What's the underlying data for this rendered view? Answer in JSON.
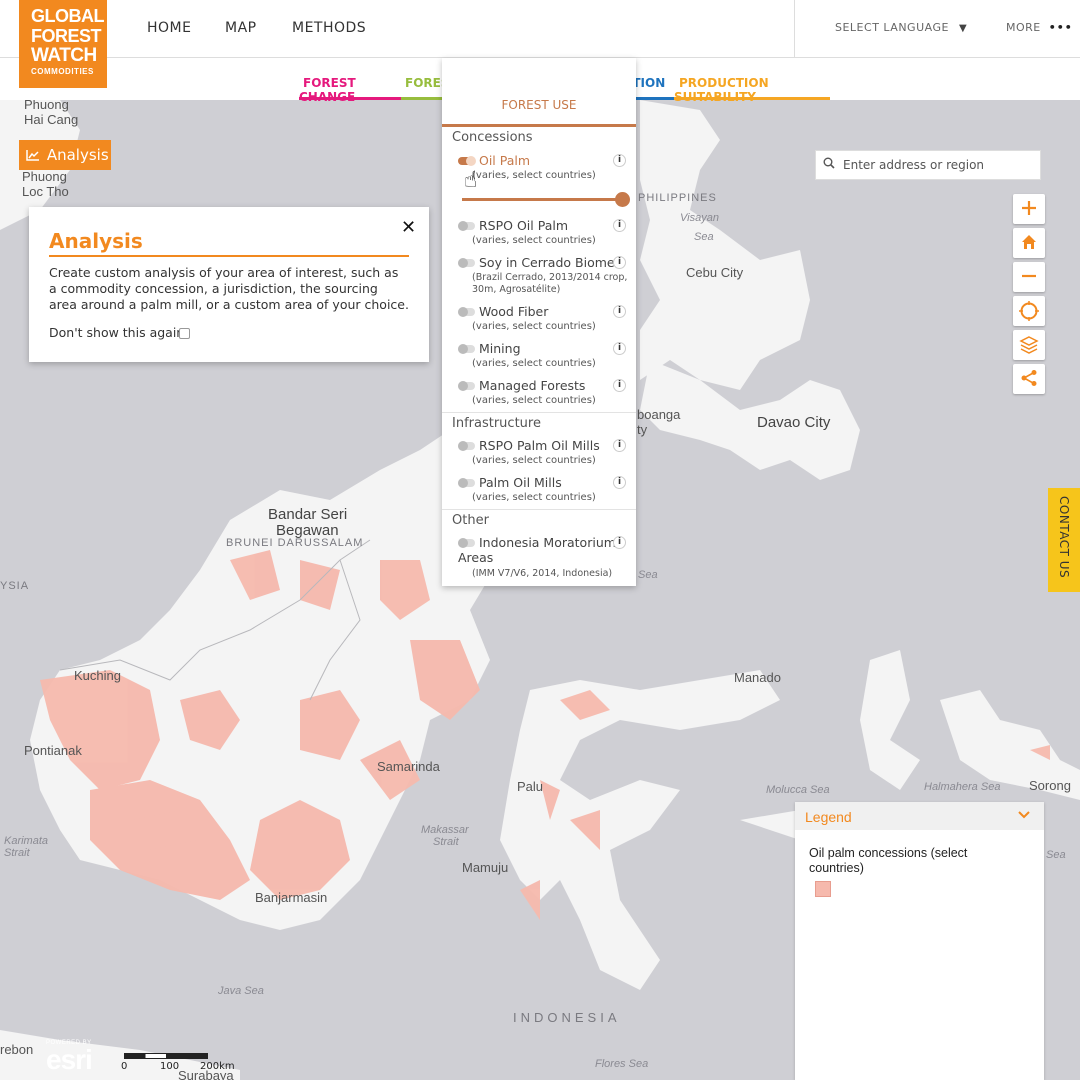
{
  "logo": {
    "line1": "GLOBAL",
    "line2": "FOREST",
    "line3": "WATCH",
    "line4": "COMMODITIES"
  },
  "nav": {
    "home": "HOME",
    "map": "MAP",
    "methods": "METHODS",
    "language": "SELECT LANGUAGE",
    "more": "MORE"
  },
  "tabs": [
    {
      "label": "FOREST CHANGE",
      "color": "#e5197d"
    },
    {
      "label": "FOREST",
      "color": "#97bd3d"
    },
    {
      "label": "ATION",
      "color": "#1e73be"
    },
    {
      "label": "PRODUCTION SUITABILITY",
      "color": "#f5a623"
    }
  ],
  "dropdown": {
    "title": "FOREST USE",
    "accent": "#c6794a",
    "groups": {
      "concessions": "Concessions",
      "infrastructure": "Infrastructure",
      "other": "Other"
    },
    "layers": [
      {
        "name": "Oil Palm",
        "sub": "(varies, select countries)",
        "on": true
      },
      {
        "name": "RSPO Oil Palm",
        "sub": "(varies, select countries)",
        "on": false
      },
      {
        "name": "Soy in Cerrado Biome",
        "sub": "(Brazil Cerrado, 2013/2014 crop,",
        "sub2": "30m, Agrosatélite)",
        "on": false
      },
      {
        "name": "Wood Fiber",
        "sub": "(varies, select countries)",
        "on": false
      },
      {
        "name": "Mining",
        "sub": "(varies, select countries)",
        "on": false
      },
      {
        "name": "Managed Forests",
        "sub": "(varies, select countries)",
        "on": false
      },
      {
        "name": "RSPO Palm Oil Mills",
        "sub": "(varies, select countries)",
        "on": false
      },
      {
        "name": "Palm Oil Mills",
        "sub": "(varies, select countries)",
        "on": false
      },
      {
        "name": "Indonesia Moratorium",
        "name2": "Areas",
        "sub": "(IMM V7/V6, 2014, Indonesia)",
        "on": false
      }
    ],
    "info": "i",
    "opacity_percent": 100
  },
  "analysis": {
    "button": "Analysis",
    "title": "Analysis",
    "close": "✕",
    "body": "Create custom analysis of your area of interest, such as a commodity concession, a jurisdiction, the sourcing area around a palm mill, or a custom area of your choice.",
    "dont_show": "Don't show this again"
  },
  "search": {
    "placeholder": "Enter address or region"
  },
  "contact": "CONTACT US",
  "legend": {
    "title": "Legend",
    "item": "Oil palm concessions (select countries)",
    "swatch_color": "#f6b9ad"
  },
  "map_labels": {
    "phuong_hai_cang_1": "Phuong",
    "phuong_hai_cang_2": "Hai Cang",
    "phuong_loc_tho_1": "Phuong",
    "phuong_loc_tho_2": "Loc Tho",
    "philippines": "PHILIPPINES",
    "visayan": "Visayan",
    "visayan_sea": "Sea",
    "cebu": "Cebu City",
    "zamboanga": "boanga",
    "zamboanga2": "ty",
    "davao": "Davao City",
    "bandar1": "Bandar Seri",
    "bandar2": "Begawan",
    "brunei": "BRUNEI DARUSSALAM",
    "malaysia": "YSIA",
    "kuching": "Kuching",
    "pontianak": "Pontianak",
    "samarinda": "Samarinda",
    "manado": "Manado",
    "palu": "Palu",
    "mamuju": "Mamuju",
    "banjarmasin": "Banjarmasin",
    "karimata1": "Karimata",
    "karimata2": "Strait",
    "makassar1": "Makassar",
    "makassar2": "Strait",
    "molucca": "Molucca Sea",
    "halmahera": "Halmahera Sea",
    "sorong": "Sorong",
    "java_sea": "Java Sea",
    "indonesia": "INDONESIA",
    "flores": "Flores Sea",
    "celebes_sea": "Sea",
    "banda_sea": "Sea",
    "palembang": "rebon",
    "surabaya": "Surabaya"
  },
  "attribution": {
    "powered": "POWERED BY",
    "esri": "esri"
  },
  "scale": {
    "s0": "0",
    "s1": "100",
    "s2": "200km"
  }
}
